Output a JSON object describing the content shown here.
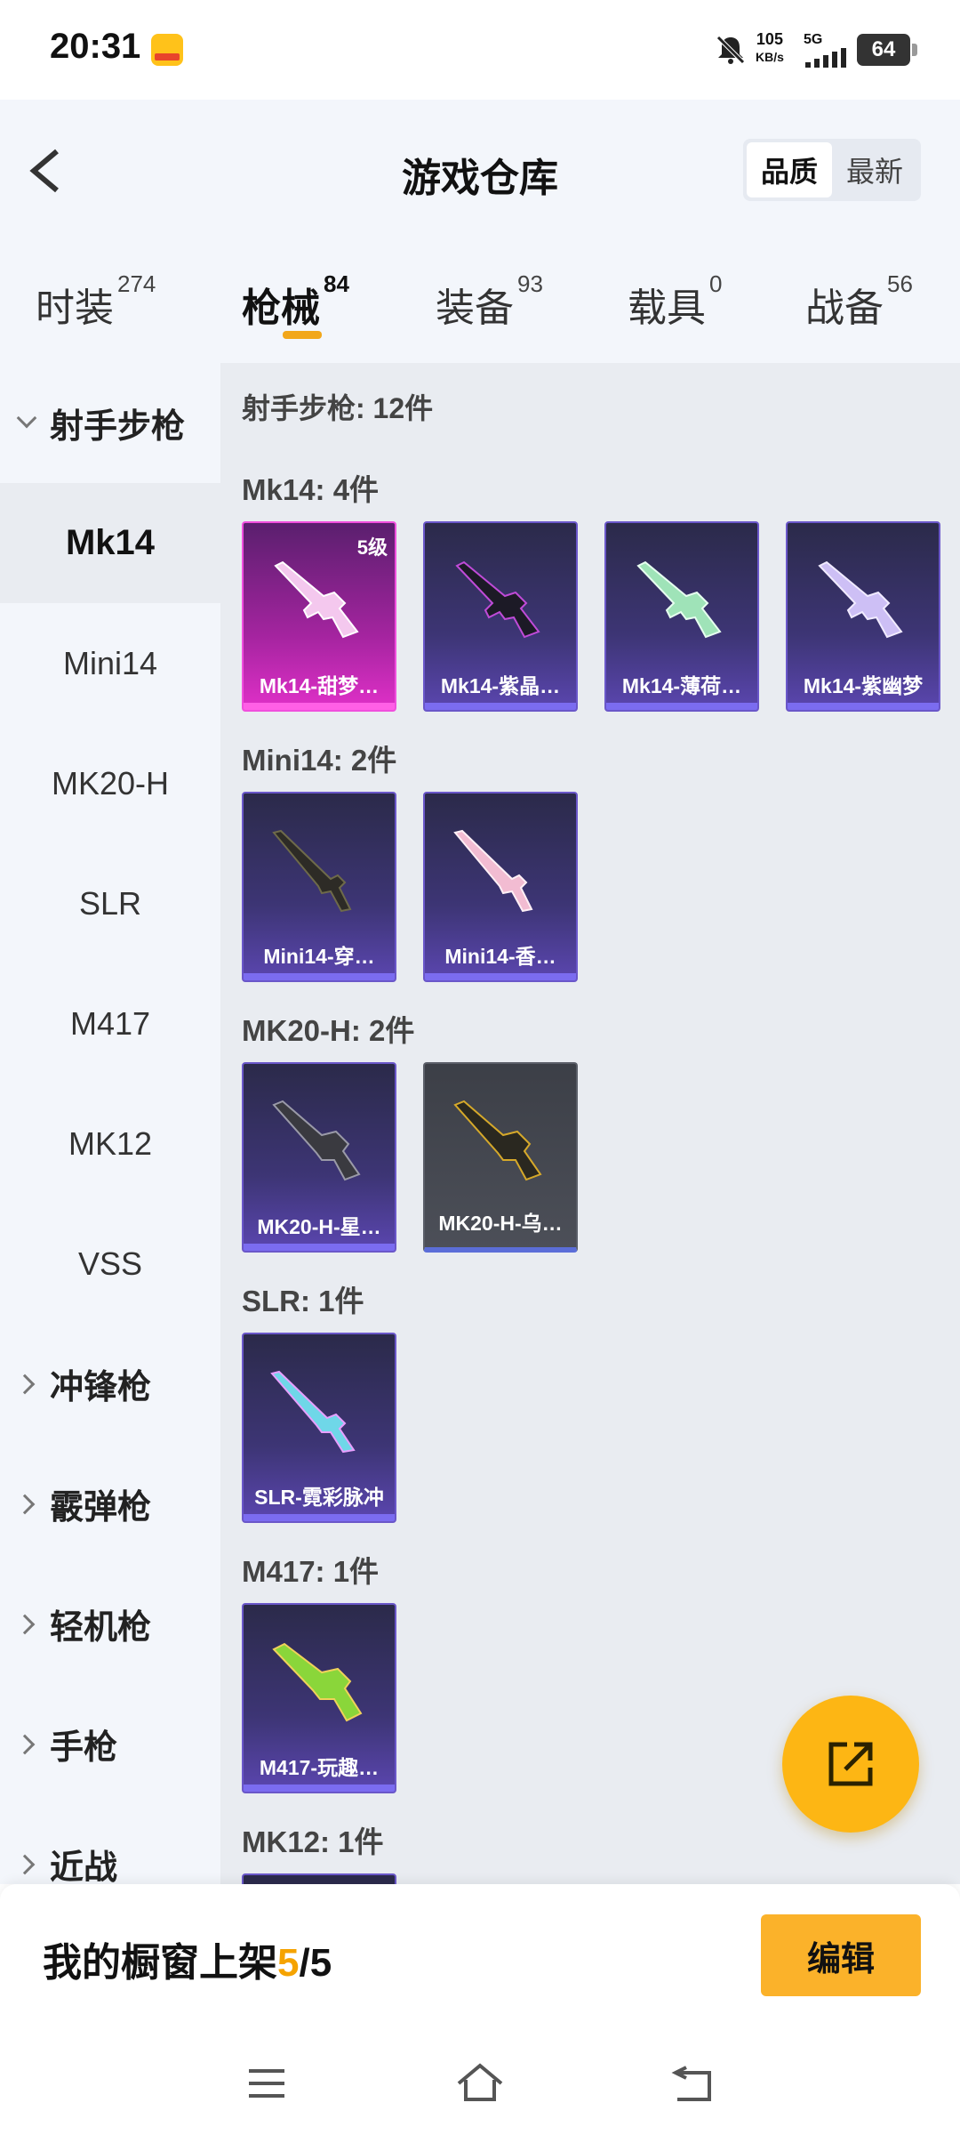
{
  "status_bar": {
    "time": "20:31",
    "net_speed_value": "105",
    "net_speed_unit": "KB/s",
    "network_type": "5G",
    "battery": "64"
  },
  "header": {
    "title": "游戏仓库",
    "sort_options": [
      "品质",
      "最新"
    ],
    "sort_selected": "品质"
  },
  "tabs": [
    {
      "label": "时装",
      "count": "274"
    },
    {
      "label": "枪械",
      "count": "84"
    },
    {
      "label": "装备",
      "count": "93"
    },
    {
      "label": "载具",
      "count": "0"
    },
    {
      "label": "战备",
      "count": "56"
    }
  ],
  "active_tab": "枪械",
  "sidebar": {
    "groups": [
      {
        "label": "射手步枪",
        "expanded": true
      },
      {
        "label": "冲锋枪",
        "expanded": false
      },
      {
        "label": "霰弹枪",
        "expanded": false
      },
      {
        "label": "轻机枪",
        "expanded": false
      },
      {
        "label": "手枪",
        "expanded": false
      },
      {
        "label": "近战",
        "expanded": false
      }
    ],
    "sub_items": [
      "Mk14",
      "Mini14",
      "MK20-H",
      "SLR",
      "M417",
      "MK12",
      "VSS"
    ],
    "active_sub_item": "Mk14"
  },
  "content": {
    "title": "射手步枪: 12件",
    "sections": [
      {
        "title": "Mk14: 4件",
        "items": [
          {
            "name": "Mk14-甜梦…",
            "level": "5级",
            "rarity": "pink"
          },
          {
            "name": "Mk14-紫晶…",
            "rarity": "purple"
          },
          {
            "name": "Mk14-薄荷…",
            "rarity": "purple"
          },
          {
            "name": "Mk14-紫幽梦",
            "rarity": "purple"
          }
        ]
      },
      {
        "title": "Mini14: 2件",
        "items": [
          {
            "name": "Mini14-穿…",
            "rarity": "purple"
          },
          {
            "name": "Mini14-香…",
            "rarity": "purple"
          }
        ]
      },
      {
        "title": "MK20-H: 2件",
        "items": [
          {
            "name": "MK20-H-星…",
            "rarity": "purple"
          },
          {
            "name": "MK20-H-乌…",
            "rarity": "grey"
          }
        ]
      },
      {
        "title": "SLR: 1件",
        "items": [
          {
            "name": "SLR-霓彩脉冲",
            "rarity": "purple"
          }
        ]
      },
      {
        "title": "M417: 1件",
        "items": [
          {
            "name": "M417-玩趣…",
            "rarity": "purple"
          }
        ]
      },
      {
        "title": "MK12: 1件",
        "items": []
      }
    ]
  },
  "showcase": {
    "label": "我的橱窗上架",
    "current": "5",
    "separator": "/",
    "total": "5",
    "edit_label": "编辑"
  },
  "colors": {
    "accent_orange": "#fdb614",
    "tab_indicator": "#f2a71b",
    "rarity_purple": "#5b46b0",
    "rarity_pink": "#e030c8",
    "rarity_grey": "#4c4f58"
  },
  "icons": {
    "back": "chevron-left-icon",
    "fab": "share-external-icon",
    "nav": [
      "menu-icon",
      "home-icon",
      "back-nav-icon"
    ]
  }
}
